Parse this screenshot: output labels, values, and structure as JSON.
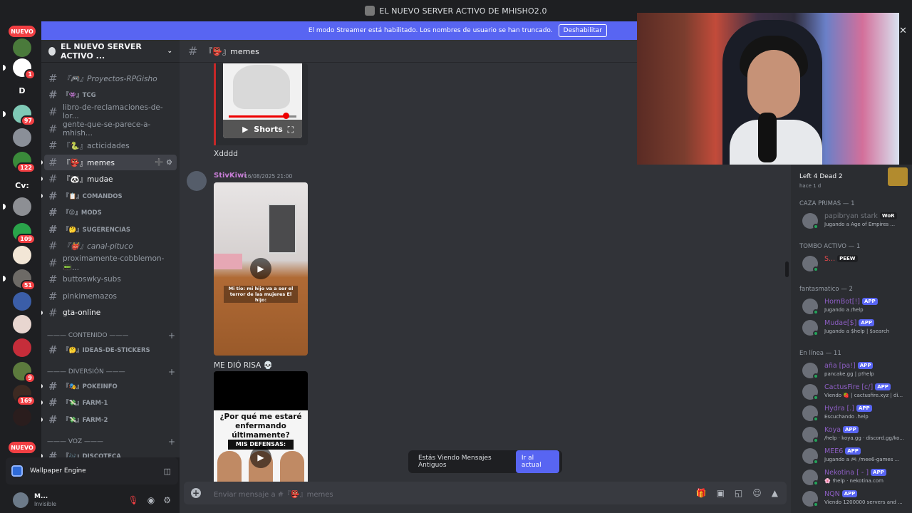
{
  "window": {
    "title": "EL NUEVO SERVER ACTIVO DE MHISHO2.0"
  },
  "banner": {
    "text": "El modo Streamer está habilitado. Los nombres de usuario se han truncado.",
    "button": "Deshabilitar"
  },
  "guilds": {
    "new_badge": "NUEVO",
    "new_badge_bottom": "NUEVO",
    "items": [
      {
        "label": "",
        "badge": "",
        "color": "#4a7a3b"
      },
      {
        "label": "",
        "badge": "1",
        "color": "#ffffff"
      },
      {
        "label": "D",
        "badge": "",
        "color": "#1e1f22"
      },
      {
        "label": "",
        "badge": "97",
        "color": "#7fc9b6"
      },
      {
        "label": "",
        "badge": "",
        "color": "#8a8f98"
      },
      {
        "label": "",
        "badge": "122",
        "color": "#3a8a3a"
      },
      {
        "label": "Cv:",
        "badge": "",
        "color": "#1e1f22"
      },
      {
        "label": "",
        "badge": "",
        "color": "#8d8f94"
      },
      {
        "label": "",
        "badge": "109",
        "color": "#2aa34a"
      },
      {
        "label": "",
        "badge": "",
        "color": "#f2e6d6"
      },
      {
        "label": "",
        "badge": "51",
        "color": "#6d6a66"
      },
      {
        "label": "",
        "badge": "",
        "color": "#3b5ea8"
      },
      {
        "label": "",
        "badge": "",
        "color": "#e8d6d0"
      },
      {
        "label": "",
        "badge": "",
        "color": "#c62d3a"
      },
      {
        "label": "",
        "badge": "9",
        "color": "#5c7a3d"
      },
      {
        "label": "",
        "badge": "169",
        "color": "#3d2a22"
      },
      {
        "label": "",
        "badge": "",
        "color": "#2a1d1d"
      }
    ]
  },
  "server": {
    "name": "EL NUEVO SERVER ACTIVO ..."
  },
  "channels": [
    {
      "label": "『🎮』Proyectos-RPGisho",
      "style": "ital"
    },
    {
      "label": "『👾』TCG",
      "style": "small-plain"
    },
    {
      "label": "libro-de-reclamaciones-de-lor...",
      "style": ""
    },
    {
      "label": "gente-que-se-parece-a-mhish...",
      "style": ""
    },
    {
      "label": "『🐍』acticidades",
      "style": ""
    },
    {
      "label": "『👺』memes",
      "style": "active"
    },
    {
      "label": "『🐼』mudae",
      "style": "unread"
    },
    {
      "label": "『📋』COMANDOS",
      "style": "small"
    },
    {
      "label": "『😡』MODS",
      "style": "small-plain"
    },
    {
      "label": "『🤔』SUGERENCIAS",
      "style": "small-plain"
    },
    {
      "label": "『👹』canal-pituco",
      "style": "ital"
    },
    {
      "label": "proximamente-cobblemon-📟...",
      "style": ""
    },
    {
      "label": "buttoswky-subs",
      "style": ""
    },
    {
      "label": "pinkimemazos",
      "style": ""
    },
    {
      "label": "gta-online",
      "style": "unread"
    }
  ],
  "categories": {
    "contenido": "——— CONTENIDO ———",
    "diversion": "——— DIVERSIÓN ———",
    "voz": "——— VOZ ———"
  },
  "channels2": [
    {
      "label": "『🤔』IDEAS-DE-STICKERS",
      "style": "small-plain"
    },
    {
      "label": "『🎭』POKEINFO",
      "style": "small"
    },
    {
      "label": "『💸』FARM-1",
      "style": "small"
    },
    {
      "label": "『💸』FARM-2",
      "style": "small"
    },
    {
      "label": "『🎶』DISCOTECA",
      "style": "small"
    }
  ],
  "activity": {
    "label": "Wallpaper Engine"
  },
  "user": {
    "name": "M...",
    "status": "Invisible"
  },
  "chat": {
    "channel": "『👺』memes",
    "shorts_label": "Shorts",
    "msg1": "Xdddd",
    "author": "StivKiwi",
    "time": "16/08/2025 21:00",
    "video1_caption": "Mi tío: mi hijo va a ser el terror de las mujeres\nEl hijo:",
    "msg2": "ME DIÓ RISA 💀",
    "video2_question": "¿Por qué me estaré enfermando últimamente?",
    "video2_sub": "MIS DEFENSAS:"
  },
  "toast": {
    "text": "Estás Viendo Mensajes Antiguos",
    "button": "Ir al actual"
  },
  "composer": {
    "placeholder": "Enviar mensaje a #『👺』memes"
  },
  "members": {
    "game": "Left 4 Dead 2",
    "game_time": "hace 1 d",
    "groups": [
      {
        "title": "CAZA PRIMAS — 1",
        "items": [
          {
            "name": "papibryan stark",
            "tag": "WoR",
            "tagdark": true,
            "sub": "Jugando a Age of Empires ...",
            "color": "grey"
          }
        ]
      },
      {
        "title": "TOMBO ACTIVO — 1",
        "items": [
          {
            "name": "S...",
            "tag": "PEEW",
            "tagdark": true,
            "sub": "",
            "color": "red"
          }
        ]
      },
      {
        "title": "fantasmatico — 2",
        "items": [
          {
            "name": "HornBot[!]",
            "tag": "APP",
            "sub": "Jugando a /help",
            "color": ""
          },
          {
            "name": "Mudae[$]",
            "tag": "APP",
            "sub": "Jugando a $help | $search",
            "color": ""
          }
        ]
      },
      {
        "title": "En línea — 11",
        "items": [
          {
            "name": "aña [pa!]",
            "tag": "APP",
            "sub": "pancake.gg | p!help",
            "color": ""
          },
          {
            "name": "CactusFire [c/]",
            "tag": "APP",
            "sub": "Viendo 🍓 | cactusfire.xyz | di...",
            "color": ""
          },
          {
            "name": "Hydra [.]",
            "tag": "APP",
            "sub": "Escuchando .help",
            "color": ""
          },
          {
            "name": "Koya",
            "tag": "APP",
            "sub": "/help · koya.gg · discord.gg/ko...",
            "color": ""
          },
          {
            "name": "MEE6",
            "tag": "APP",
            "sub": "Jugando a 🎮 /mee6-games ...",
            "color": ""
          },
          {
            "name": "Nekotina [ - ]",
            "tag": "APP",
            "sub": "🌸 !help · nekotina.com",
            "color": ""
          },
          {
            "name": "NQN",
            "tag": "APP",
            "sub": "Viendo 1200000 servers and ...",
            "color": ""
          }
        ]
      }
    ]
  }
}
